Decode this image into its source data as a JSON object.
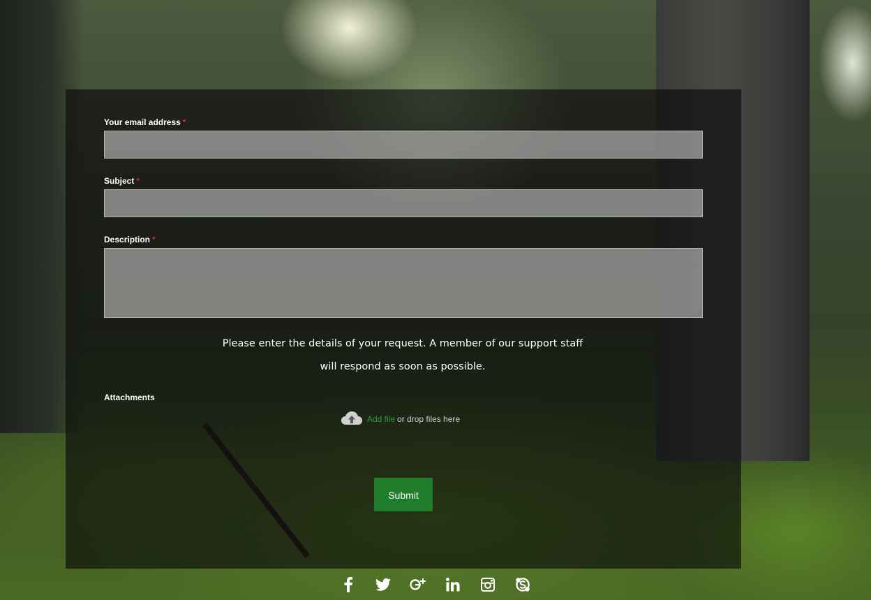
{
  "form": {
    "email_label": "Your email address",
    "subject_label": "Subject",
    "description_label": "Description",
    "required_marker": "*",
    "email_value": "",
    "subject_value": "",
    "description_value": "",
    "info_text": "Please enter the details of your request. A member of our support staff will respond as soon as possible.",
    "attachments_label": "Attachments",
    "add_file_link": "Add file",
    "drop_text": "or drop files here",
    "submit_label": "Submit"
  },
  "social": {
    "icons": [
      "facebook-icon",
      "twitter-icon",
      "google-plus-icon",
      "linkedin-icon",
      "instagram-icon",
      "skype-icon"
    ]
  },
  "colors": {
    "submit_bg": "#1f7d2c",
    "link_green": "#2d9b3a",
    "required_red": "#e02424"
  }
}
